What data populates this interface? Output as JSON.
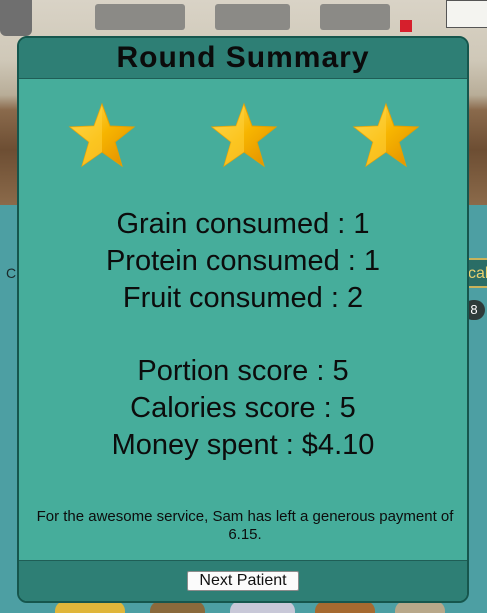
{
  "modal": {
    "title": "Round Summary",
    "stars": {
      "earned": 3,
      "total": 3,
      "icon": "star-icon"
    },
    "consumption": [
      {
        "label": "Grain consumed : 1"
      },
      {
        "label": "Protein consumed : 1"
      },
      {
        "label": "Fruit consumed : 2"
      }
    ],
    "scores": [
      {
        "label": "Portion score : 5"
      },
      {
        "label": "Calories score : 5"
      },
      {
        "label": "Money spent : $4.10"
      }
    ],
    "message": "For the awesome service, Sam has left a generous payment of 6.15.",
    "next_button": "Next Patient"
  },
  "background": {
    "left_text": "C",
    "right_tab_text": "cal",
    "right_badge_text": "8"
  },
  "colors": {
    "modal_bg": "#46ad9b",
    "modal_header": "#2e7f75",
    "star_gold": "#f5b800"
  }
}
